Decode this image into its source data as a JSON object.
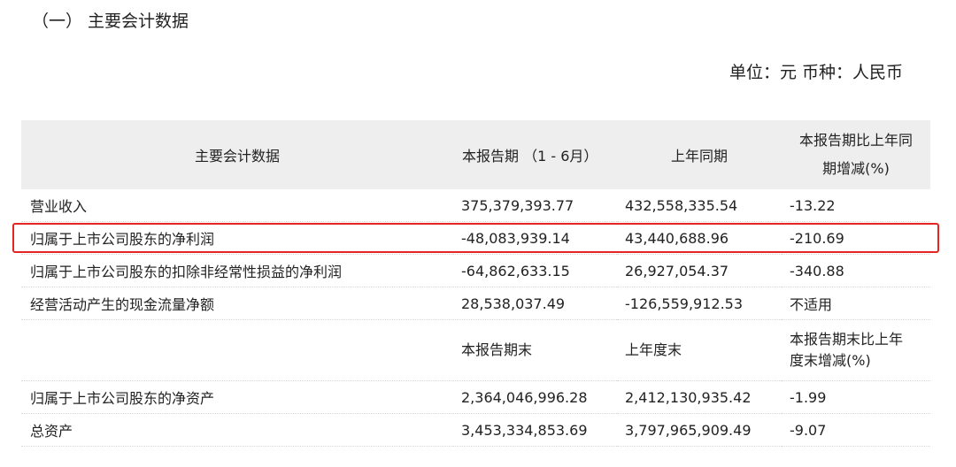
{
  "section_title": "（一） 主要会计数据",
  "unit_line": "单位：元 币种：人民币",
  "table": {
    "headers": {
      "item": "主要会计数据",
      "current": "本报告期 （1 - 6月）",
      "prior": "上年同期",
      "change_line1": "本报告期比上年同",
      "change_line2": "期增减(%)"
    },
    "rows": [
      {
        "item": "营业收入",
        "current": "375,379,393.77",
        "prior": "432,558,335.54",
        "change": "-13.22"
      },
      {
        "item": "归属于上市公司股东的净利润",
        "current": "-48,083,939.14",
        "prior": "43,440,688.96",
        "change": "-210.69"
      },
      {
        "item": "归属于上市公司股东的扣除非经常性损益的净利润",
        "current": "-64,862,633.15",
        "prior": "26,927,054.37",
        "change": "-340.88"
      },
      {
        "item": "经营活动产生的现金流量净额",
        "current": "28,538,037.49",
        "prior": "-126,559,912.53",
        "change": "不适用"
      }
    ],
    "subheaders": {
      "current": "本报告期末",
      "prior": "上年度末",
      "change_line1": "本报告期末比上年",
      "change_line2": "度末增减(%)"
    },
    "rows2": [
      {
        "item": "归属于上市公司股东的净资产",
        "current": "2,364,046,996.28",
        "prior": "2,412,130,935.42",
        "change": "-1.99"
      },
      {
        "item": "总资产",
        "current": "3,453,334,853.69",
        "prior": "3,797,965,909.49",
        "change": "-9.07"
      }
    ]
  },
  "highlight_color": "#e52521"
}
